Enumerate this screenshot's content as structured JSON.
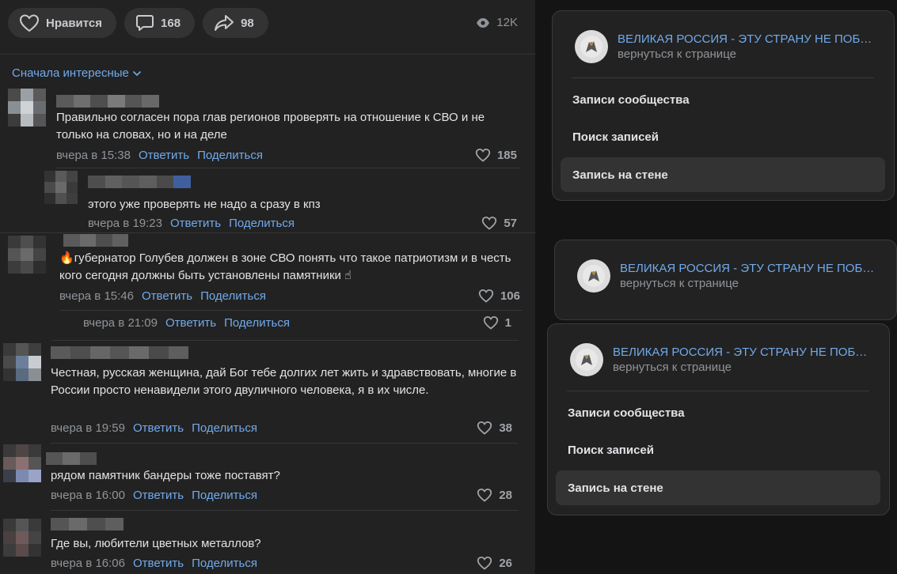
{
  "actions": {
    "like_label": "Нравится",
    "comments_count": "168",
    "shares_count": "98",
    "views_count": "12K"
  },
  "sort_label": "Сначала интересные",
  "links": {
    "reply": "Ответить",
    "share": "Поделиться"
  },
  "comments": [
    {
      "text": "Правильно согласен пора глав регионов проверять на отношение к СВО и не только на словах, но и на деле",
      "time": "вчера в 15:38",
      "likes": "185"
    },
    {
      "text": "этого уже проверять не надо а сразу в кпз",
      "time": "вчера в 19:23",
      "likes": "57"
    },
    {
      "emoji": "🔥",
      "text": "губернатор Голубев должен в зоне СВО понять что такое патриотизм и в честь кого сегодня должны быть установлены памятники ☝",
      "time": "вчера в 15:46",
      "likes": "106"
    },
    {
      "text": "",
      "time": "вчера в 21:09",
      "likes": "1"
    },
    {
      "text": "Честная, русская женщина, дай Бог тебе долгих лет жить и здравствовать, многие в России просто ненавидели этого двуличного человека, я в их числе.",
      "time": "вчера в 19:59",
      "likes": "38"
    },
    {
      "text": "рядом памятник бандеры тоже поставят?",
      "time": "вчера в 16:00",
      "likes": "28"
    },
    {
      "text": "Где вы, любители цветных металлов?",
      "time": "вчера в 16:06",
      "likes": "26"
    }
  ],
  "group": {
    "name": "ВЕЛИКАЯ РОССИЯ - ЭТУ СТРАНУ НЕ ПОБ…",
    "back": "вернуться к странице"
  },
  "menu": {
    "items": [
      "Записи сообщества",
      "Поиск записей",
      "Запись на стене"
    ]
  }
}
